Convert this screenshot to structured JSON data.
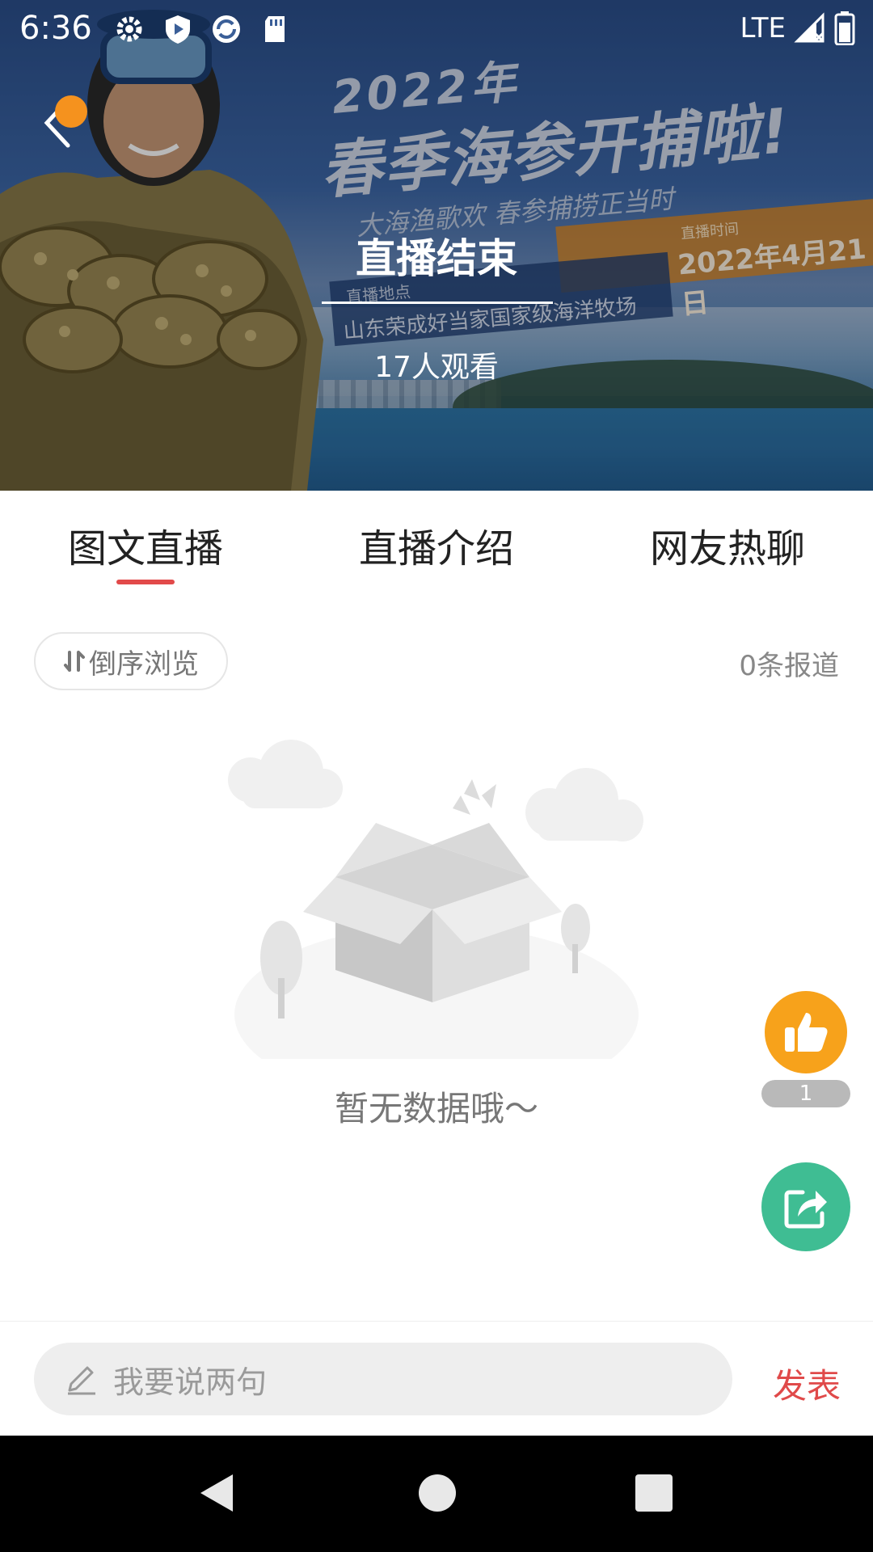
{
  "status_bar": {
    "time": "6:36",
    "network": "LTE",
    "icons": [
      "gear-icon",
      "shield-play-icon",
      "sync-icon",
      "sdcard-icon",
      "signal-icon",
      "battery-icon"
    ]
  },
  "hero": {
    "banner": {
      "year": "2022年",
      "headline": "春季海参开捕啦!",
      "subline": "大海渔歌欢 春参捕捞正当时",
      "date_label": "直播时间",
      "date": "2022年4月21日",
      "place_label": "直播地点",
      "place": "山东荣成好当家国家级海洋牧场"
    },
    "live_status": "直播结束",
    "viewers": "17人观看"
  },
  "tabs": [
    {
      "label": "图文直播",
      "active": true
    },
    {
      "label": "直播介绍",
      "active": false
    },
    {
      "label": "网友热聊",
      "active": false
    }
  ],
  "toolbar": {
    "sort_label": "倒序浏览",
    "report_count": "0条报道"
  },
  "empty_state": {
    "message": "暂无数据哦～"
  },
  "actions": {
    "like_count": "1"
  },
  "comment_bar": {
    "placeholder": "我要说两句",
    "publish_label": "发表"
  },
  "colors": {
    "accent_red": "#e24a4a",
    "like_orange": "#f7a21b",
    "share_green": "#3fbd93",
    "notif_orange": "#f5921e"
  }
}
